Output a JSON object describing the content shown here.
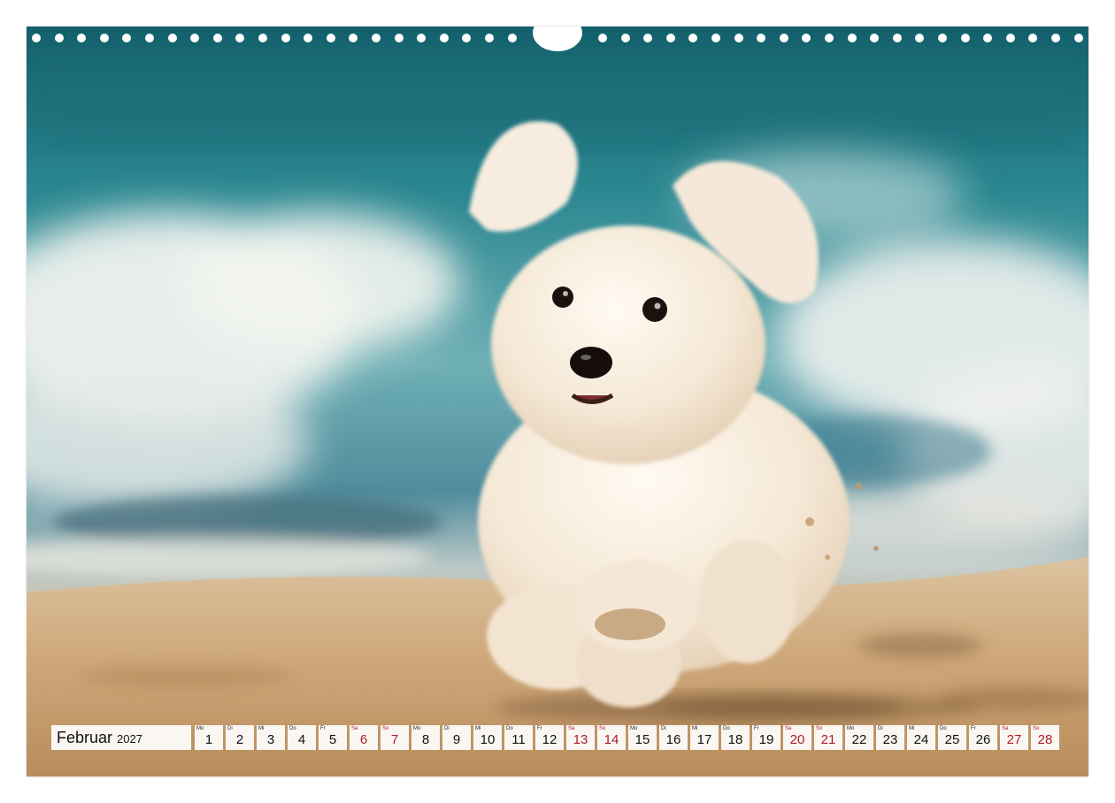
{
  "calendar": {
    "month": "Februar",
    "year": "2027",
    "days": [
      {
        "abbr": "Mo",
        "num": "1",
        "weekend": false
      },
      {
        "abbr": "Di",
        "num": "2",
        "weekend": false
      },
      {
        "abbr": "Mi",
        "num": "3",
        "weekend": false
      },
      {
        "abbr": "Do",
        "num": "4",
        "weekend": false
      },
      {
        "abbr": "Fr",
        "num": "5",
        "weekend": false
      },
      {
        "abbr": "Sa",
        "num": "6",
        "weekend": true
      },
      {
        "abbr": "So",
        "num": "7",
        "weekend": true
      },
      {
        "abbr": "Mo",
        "num": "8",
        "weekend": false
      },
      {
        "abbr": "Di",
        "num": "9",
        "weekend": false
      },
      {
        "abbr": "Mi",
        "num": "10",
        "weekend": false
      },
      {
        "abbr": "Do",
        "num": "11",
        "weekend": false
      },
      {
        "abbr": "Fr",
        "num": "12",
        "weekend": false
      },
      {
        "abbr": "Sa",
        "num": "13",
        "weekend": true
      },
      {
        "abbr": "So",
        "num": "14",
        "weekend": true
      },
      {
        "abbr": "Mo",
        "num": "15",
        "weekend": false
      },
      {
        "abbr": "Di",
        "num": "16",
        "weekend": false
      },
      {
        "abbr": "Mi",
        "num": "17",
        "weekend": false
      },
      {
        "abbr": "Do",
        "num": "18",
        "weekend": false
      },
      {
        "abbr": "Fr",
        "num": "19",
        "weekend": false
      },
      {
        "abbr": "Sa",
        "num": "20",
        "weekend": true
      },
      {
        "abbr": "So",
        "num": "21",
        "weekend": true
      },
      {
        "abbr": "Mo",
        "num": "22",
        "weekend": false
      },
      {
        "abbr": "Di",
        "num": "23",
        "weekend": false
      },
      {
        "abbr": "Mi",
        "num": "24",
        "weekend": false
      },
      {
        "abbr": "Do",
        "num": "25",
        "weekend": false
      },
      {
        "abbr": "Fr",
        "num": "26",
        "weekend": false
      },
      {
        "abbr": "Sa",
        "num": "27",
        "weekend": true
      },
      {
        "abbr": "So",
        "num": "28",
        "weekend": true
      }
    ]
  },
  "colors": {
    "sea_deep": "#1d6f78",
    "sea_light": "#5aa5ad",
    "foam": "#eef2f0",
    "sand": "#c9a275",
    "dog_fur": "#f6ece0",
    "weekend_text": "#b01a2a"
  },
  "photo": {
    "subject": "white-dog-running-on-beach"
  }
}
